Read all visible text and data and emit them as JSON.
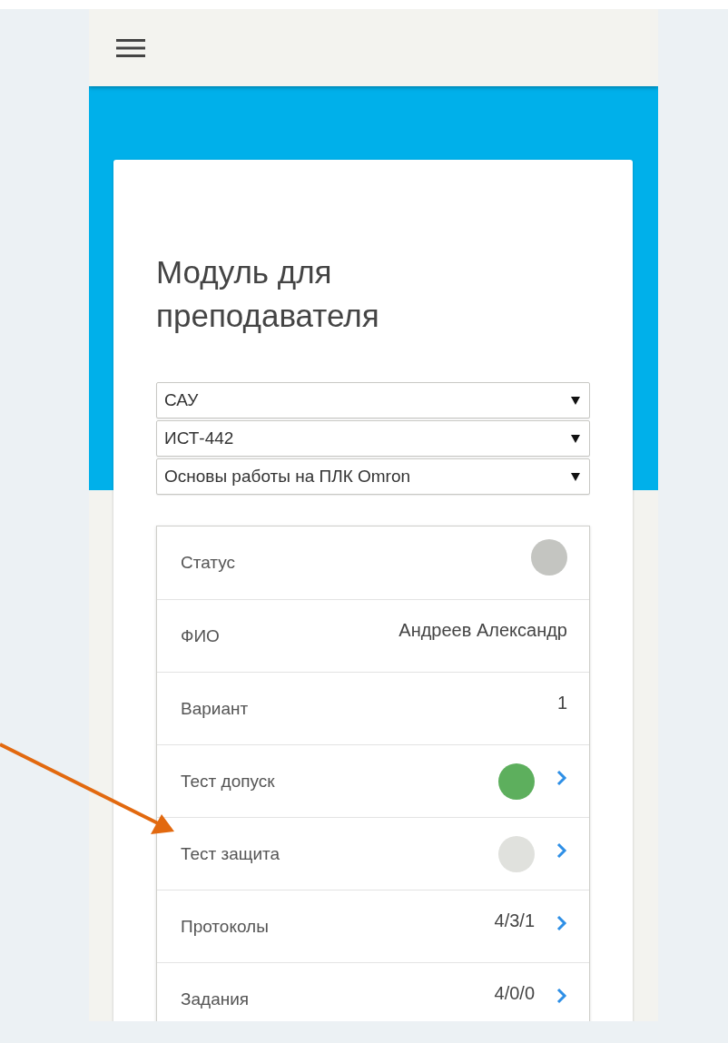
{
  "card": {
    "title": "Модуль для преподавателя",
    "selects": [
      {
        "value": "САУ"
      },
      {
        "value": "ИСТ-442"
      },
      {
        "value": "Основы работы на ПЛК Omron"
      }
    ],
    "rows": [
      {
        "kind": "dot",
        "label": "Статус",
        "color": "#c4c5c1",
        "chevron": false
      },
      {
        "kind": "text",
        "label": "ФИО",
        "value": "Андреев Александр",
        "chevron": false
      },
      {
        "kind": "text",
        "label": "Вариант",
        "value": "1",
        "chevron": false
      },
      {
        "kind": "dot",
        "label": "Тест допуск",
        "color": "#5daf5d",
        "chevron": true
      },
      {
        "kind": "dot",
        "label": "Тест защита",
        "color": "#e0e1dd",
        "chevron": true
      },
      {
        "kind": "text",
        "label": "Протоколы",
        "value": "4/3/1",
        "chevron": true
      },
      {
        "kind": "text",
        "label": "Задания",
        "value": "4/0/0",
        "chevron": true
      }
    ]
  },
  "annotation": {
    "kind": "arrow"
  }
}
